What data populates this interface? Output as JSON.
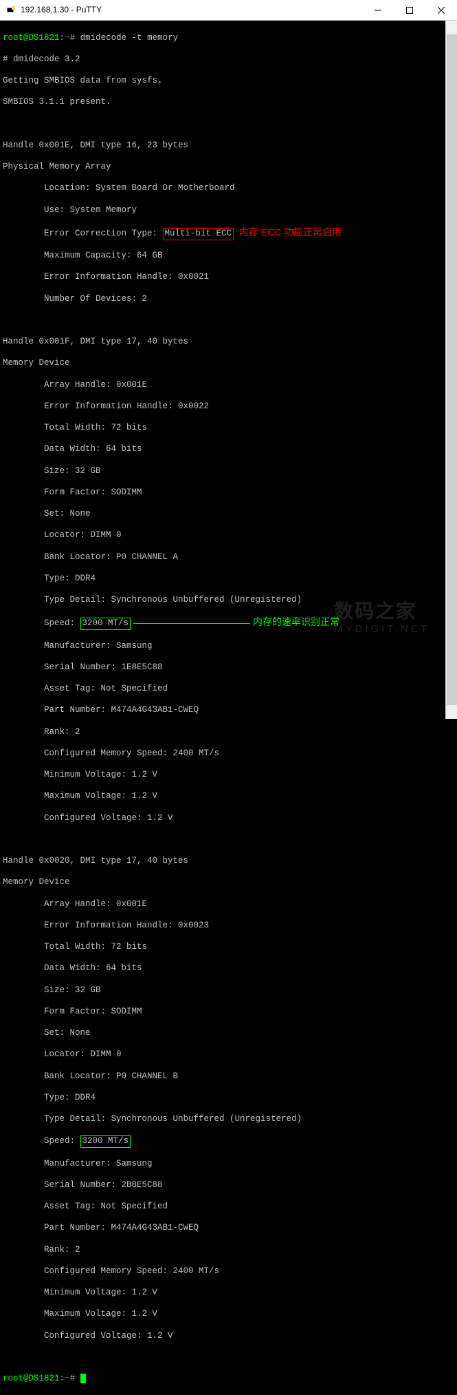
{
  "window": {
    "title": "192.168.1.30 - PuTTY"
  },
  "prompt": {
    "user": "root",
    "at": "@",
    "host": "DS1821",
    "colon": ":",
    "path": "~",
    "hash": "#",
    "cmd": "dmidecode -t memory"
  },
  "header": {
    "l1": "# dmidecode 3.2",
    "l2": "Getting SMBIOS data from sysfs.",
    "l3": "SMBIOS 3.1.1 present."
  },
  "handle1": {
    "head": "Handle 0x001E, DMI type 16, 23 bytes",
    "title": "Physical Memory Array",
    "loc": "        Location: System Board Or Motherboard",
    "use": "        Use: System Memory",
    "ecc_pre": "        Error Correction Type: ",
    "ecc_val": "Multi-bit ECC",
    "max": "        Maximum Capacity: 64 GB",
    "errh": "        Error Information Handle: 0x0021",
    "num": "        Number Of Devices: 2"
  },
  "annot": {
    "red": "内存 ECC 功能正常启用",
    "green": "内存的速率识别正常"
  },
  "dev1": {
    "head": "Handle 0x001F, DMI type 17, 40 bytes",
    "title": "Memory Device",
    "arr": "        Array Handle: 0x001E",
    "errh": "        Error Information Handle: 0x0022",
    "tw": "        Total Width: 72 bits",
    "dw": "        Data Width: 64 bits",
    "size": "        Size: 32 GB",
    "form": "        Form Factor: SODIMM",
    "set": "        Set: None",
    "loc": "        Locator: DIMM 0",
    "bank": "        Bank Locator: P0 CHANNEL A",
    "type": "        Type: DDR4",
    "detail": "        Type Detail: Synchronous Unbuffered (Unregistered)",
    "speed_pre": "        Speed: ",
    "speed_val": "3200 MT/s",
    "mfr": "        Manufacturer: Samsung",
    "sn": "        Serial Number: 1E8E5C88",
    "asset": "        Asset Tag: Not Specified",
    "part": "        Part Number: M474A4G43AB1-CWEQ",
    "rank": "        Rank: 2",
    "cspd": "        Configured Memory Speed: 2400 MT/s",
    "minv": "        Minimum Voltage: 1.2 V",
    "maxv": "        Maximum Voltage: 1.2 V",
    "cfgv": "        Configured Voltage: 1.2 V"
  },
  "dev2": {
    "head": "Handle 0x0020, DMI type 17, 40 bytes",
    "title": "Memory Device",
    "arr": "        Array Handle: 0x001E",
    "errh": "        Error Information Handle: 0x0023",
    "tw": "        Total Width: 72 bits",
    "dw": "        Data Width: 64 bits",
    "size": "        Size: 32 GB",
    "form": "        Form Factor: SODIMM",
    "set": "        Set: None",
    "loc": "        Locator: DIMM 0",
    "bank": "        Bank Locator: P0 CHANNEL B",
    "type": "        Type: DDR4",
    "detail": "        Type Detail: Synchronous Unbuffered (Unregistered)",
    "speed_pre": "        Speed: ",
    "speed_val": "3200 MT/s",
    "mfr": "        Manufacturer: Samsung",
    "sn": "        Serial Number: 2B8E5C88",
    "asset": "        Asset Tag: Not Specified",
    "part": "        Part Number: M474A4G43AB1-CWEQ",
    "rank": "        Rank: 2",
    "cspd": "        Configured Memory Speed: 2400 MT/s",
    "minv": "        Minimum Voltage: 1.2 V",
    "maxv": "        Maximum Voltage: 1.2 V",
    "cfgv": "        Configured Voltage: 1.2 V"
  },
  "watermark": {
    "cn": "数码之家",
    "en": "MYDIGIT.NET"
  }
}
